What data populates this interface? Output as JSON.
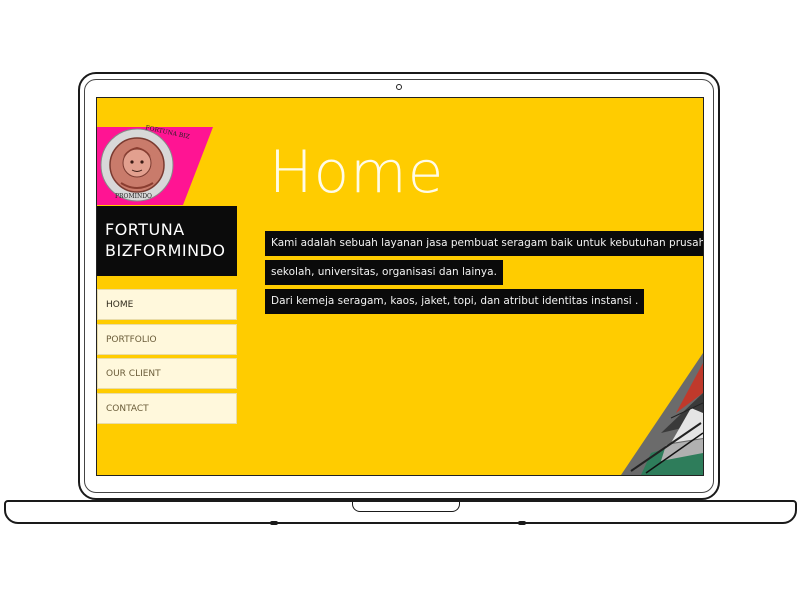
{
  "site": {
    "logo": {
      "ring_text_top": "FORTUNA BIZ",
      "ring_text_bottom": "PROMINDO"
    },
    "brand_line1": "FORTUNA",
    "brand_line2": "BIZFORMINDO",
    "nav": [
      {
        "label": "HOME",
        "active": true
      },
      {
        "label": "PORTFOLIO",
        "active": false
      },
      {
        "label": "OUR CLIENT",
        "active": false
      },
      {
        "label": "CONTACT",
        "active": false
      }
    ],
    "heading": "Home",
    "paragraph_lines": [
      "Kami adalah sebuah layanan jasa pembuat seragam baik untuk kebutuhan prusahaan,",
      "sekolah, universitas, organisasi dan lainya.",
      "Dari kemeja seragam, kaos, jaket, topi, dan atribut identitas instansi ."
    ]
  },
  "colors": {
    "background": "#ffcc00",
    "logo_accent": "#ff1493",
    "brand_box": "#0b0b0b",
    "nav_item_bg": "#fff8dc"
  },
  "icons": [
    "laptop-camera",
    "logo-badge"
  ]
}
